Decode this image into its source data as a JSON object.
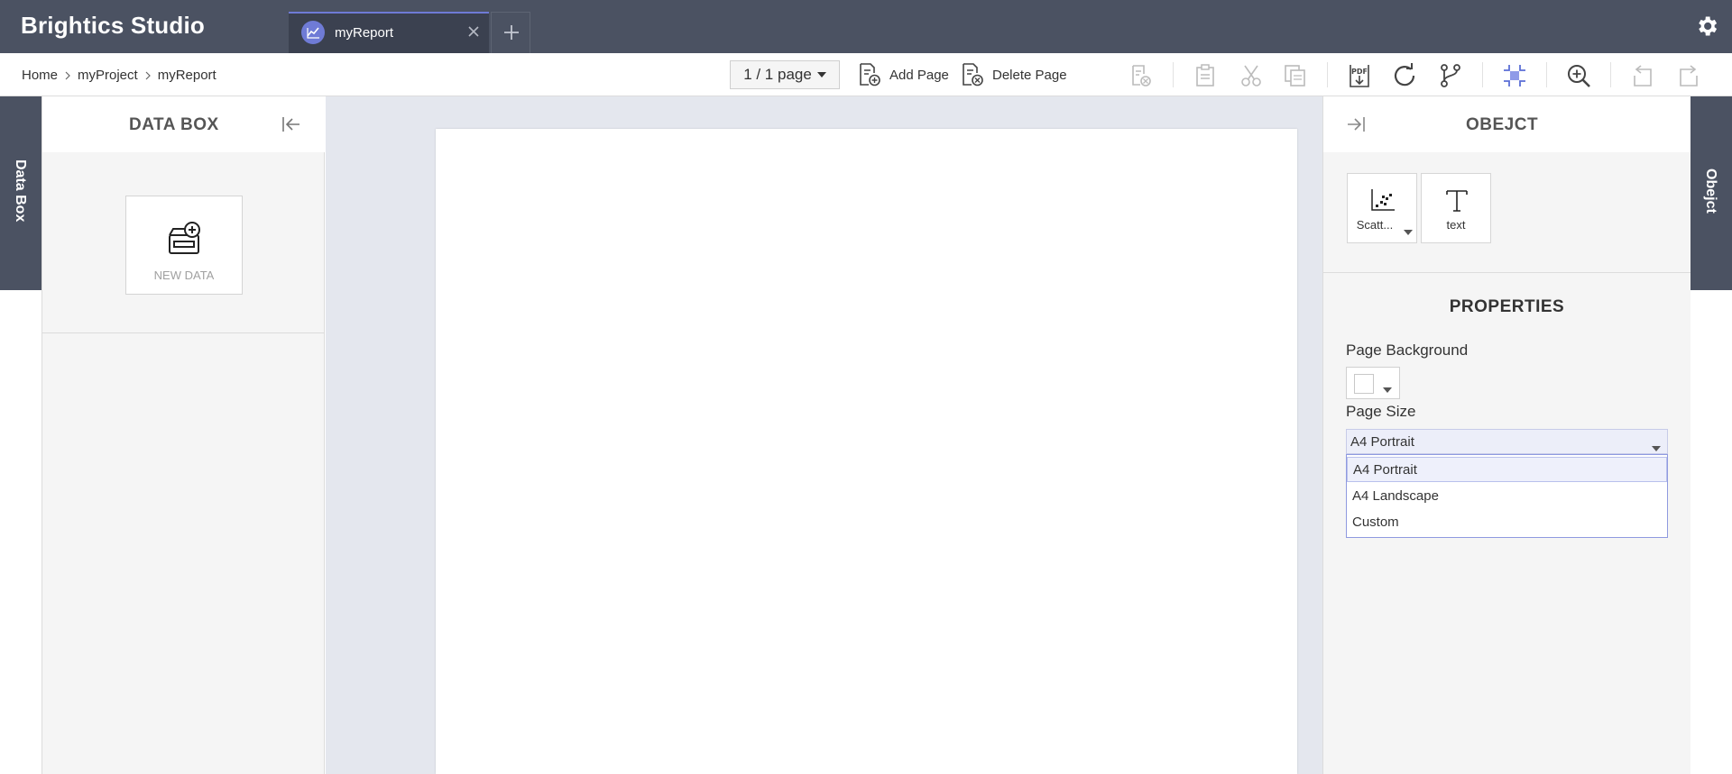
{
  "app": {
    "title": "Brightics Studio"
  },
  "tabs": [
    {
      "label": "myReport"
    }
  ],
  "breadcrumb": [
    "Home",
    "myProject",
    "myReport"
  ],
  "toolbar": {
    "page_selector": "1 / 1 page",
    "add_page": "Add Page",
    "delete_page": "Delete Page"
  },
  "left_panel": {
    "vertical_tab": "Data Box",
    "title": "DATA BOX",
    "new_data_label": "NEW DATA"
  },
  "right_panel": {
    "vertical_tab": "Obejct",
    "title": "OBEJCT",
    "objects": [
      {
        "label": "Scatt...",
        "icon": "scatter-chart-icon"
      },
      {
        "label": "text",
        "icon": "text-icon"
      }
    ],
    "properties_title": "PROPERTIES",
    "page_background_label": "Page Background",
    "page_background_color": "#ffffff",
    "page_size_label": "Page Size",
    "page_size_value": "A4 Portrait",
    "page_size_options": [
      "A4 Portrait",
      "A4 Landscape",
      "Custom"
    ]
  },
  "colors": {
    "topbar": "#4b5262",
    "accent": "#6f7bd6",
    "canvas": "#e4e7ee"
  }
}
